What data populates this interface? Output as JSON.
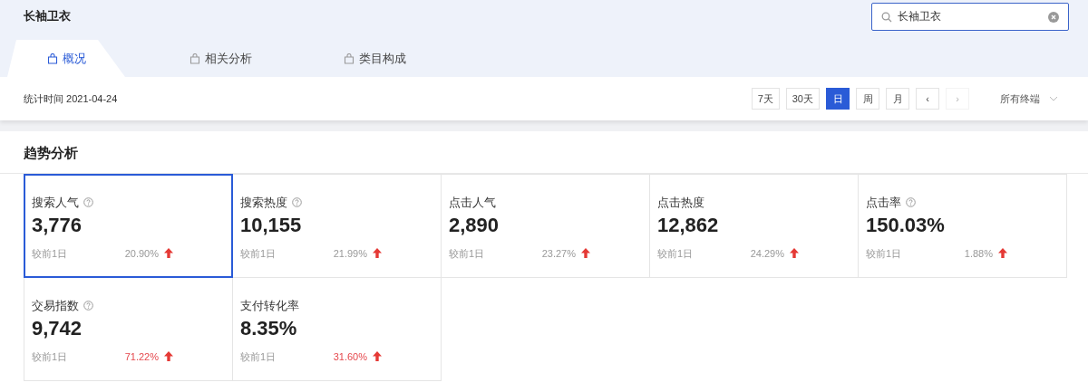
{
  "page_title": "长袖卫衣",
  "search": {
    "value": "长袖卫衣"
  },
  "tabs": [
    {
      "label": "概况",
      "selected": true
    },
    {
      "label": "相关分析",
      "selected": false
    },
    {
      "label": "类目构成",
      "selected": false
    }
  ],
  "stat_time": "统计时间 2021-04-24",
  "period_buttons": [
    {
      "label": "7天",
      "selected": false,
      "disabled": false
    },
    {
      "label": "30天",
      "selected": false,
      "disabled": false
    },
    {
      "label": "日",
      "selected": true,
      "disabled": false
    },
    {
      "label": "周",
      "selected": false,
      "disabled": false
    },
    {
      "label": "月",
      "selected": false,
      "disabled": false
    },
    {
      "label": "‹",
      "selected": false,
      "disabled": false
    },
    {
      "label": "›",
      "selected": false,
      "disabled": true
    }
  ],
  "terminal_dropdown": "所有终端",
  "section_title": "趋势分析",
  "metrics": [
    {
      "name": "搜索人气",
      "help": true,
      "value": "3,776",
      "compare": "较前1日",
      "change": "20.90%",
      "color": "#999999",
      "selected": true
    },
    {
      "name": "搜索热度",
      "help": true,
      "value": "10,155",
      "compare": "较前1日",
      "change": "21.99%",
      "color": "#999999",
      "selected": false
    },
    {
      "name": "点击人气",
      "help": false,
      "value": "2,890",
      "compare": "较前1日",
      "change": "23.27%",
      "color": "#999999",
      "selected": false
    },
    {
      "name": "点击热度",
      "help": false,
      "value": "12,862",
      "compare": "较前1日",
      "change": "24.29%",
      "color": "#999999",
      "selected": false
    },
    {
      "name": "点击率",
      "help": true,
      "value": "150.03%",
      "compare": "较前1日",
      "change": "1.88%",
      "color": "#999999",
      "selected": false
    },
    {
      "name": "交易指数",
      "help": true,
      "value": "9,742",
      "compare": "较前1日",
      "change": "71.22%",
      "color": "#e5484d",
      "selected": false
    },
    {
      "name": "支付转化率",
      "help": false,
      "value": "8.35%",
      "compare": "较前1日",
      "change": "31.60%",
      "color": "#e5484d",
      "selected": false
    }
  ]
}
